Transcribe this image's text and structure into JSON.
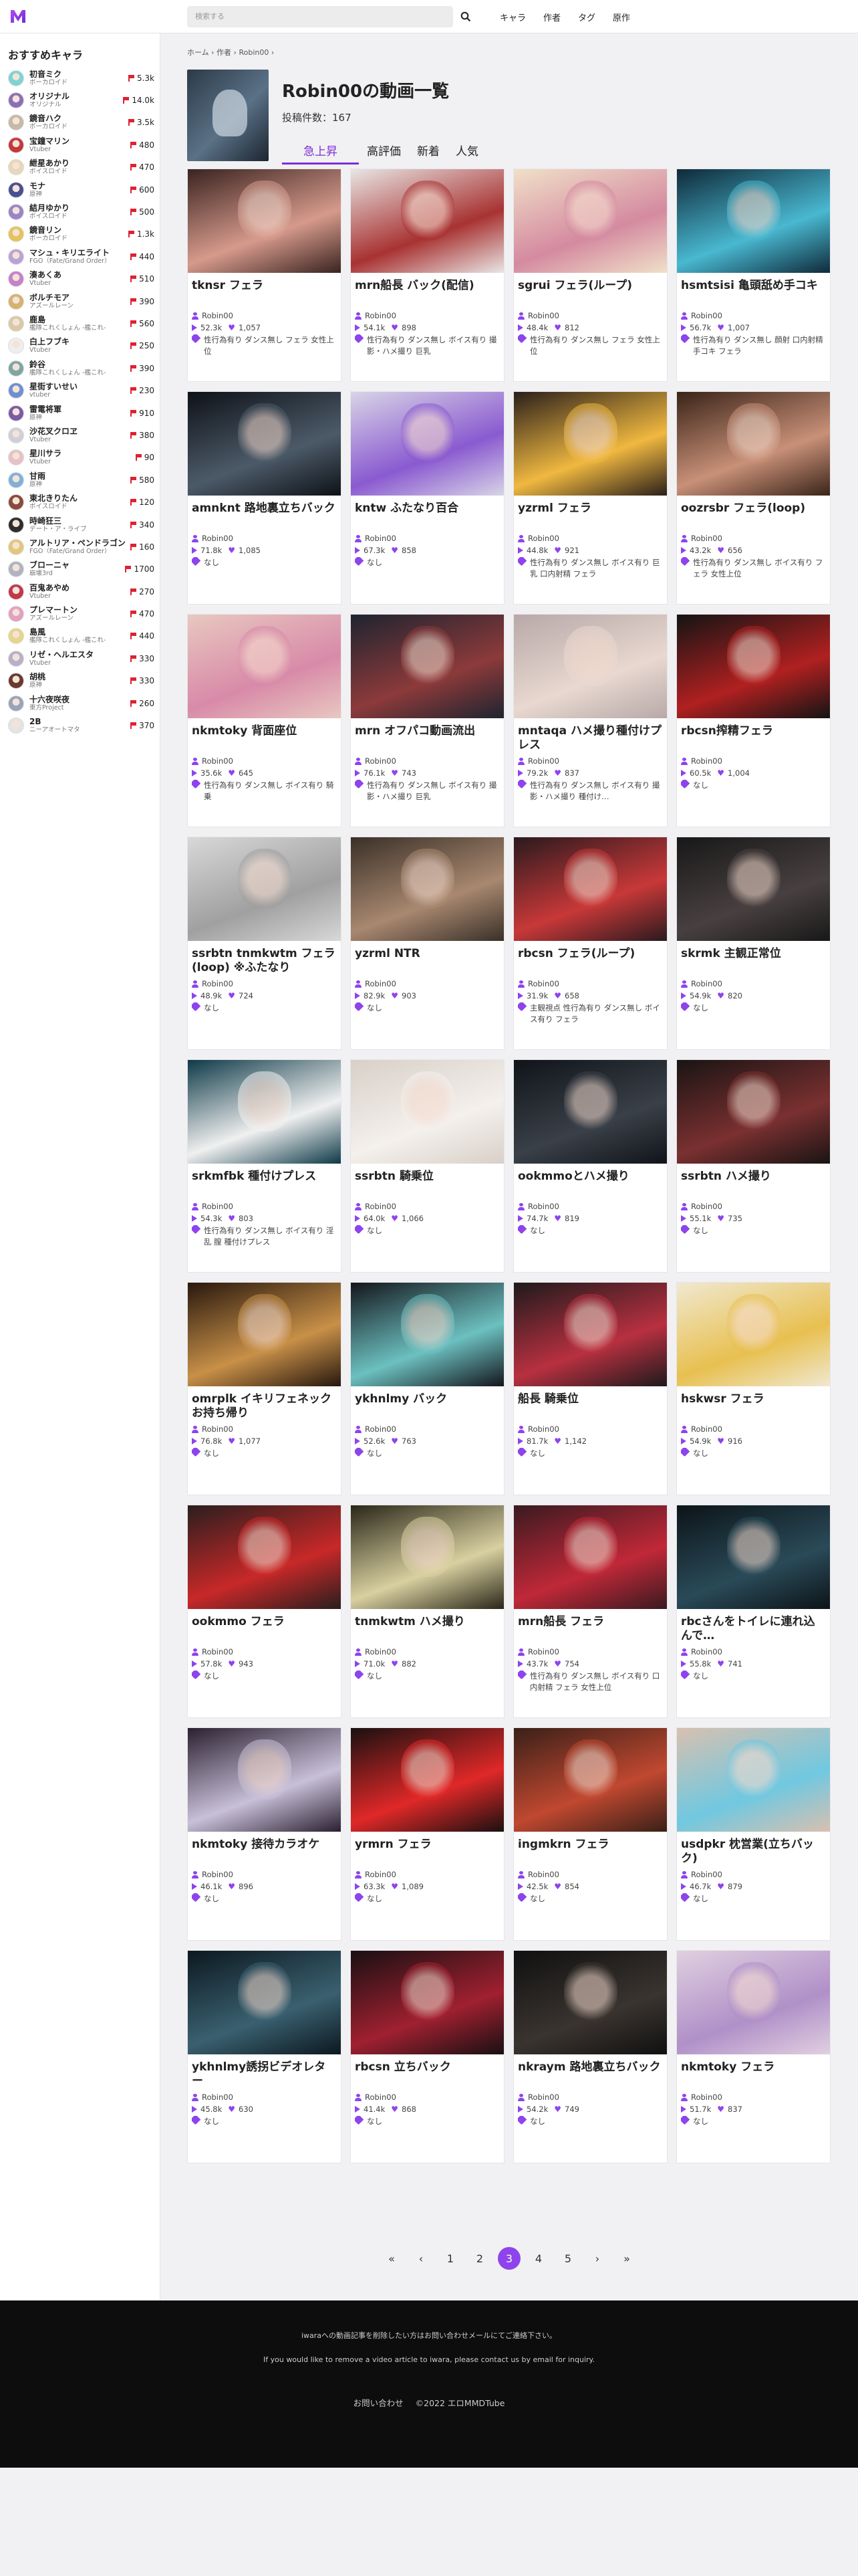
{
  "topbar": {
    "search_placeholder": "検索する",
    "nav": [
      "キャラ",
      "作者",
      "タグ",
      "原作"
    ]
  },
  "sidebar": {
    "title": "おすすめキャラ",
    "items": [
      {
        "name": "初音ミク",
        "sub": "ボーカロイド",
        "count": "5.3k",
        "avatar": "#7fd3d3"
      },
      {
        "name": "オリジナル",
        "sub": "オリジナル",
        "count": "14.0k",
        "avatar": "#8a6fb8"
      },
      {
        "name": "鏡音ハク",
        "sub": "ボーカロイド",
        "count": "3.5k",
        "avatar": "#c7b8a8"
      },
      {
        "name": "宝鐘マリン",
        "sub": "Vtuber",
        "count": "480",
        "avatar": "#c23a3a"
      },
      {
        "name": "紲星あかり",
        "sub": "ボイスロイド",
        "count": "470",
        "avatar": "#e8d7b8"
      },
      {
        "name": "モナ",
        "sub": "原神",
        "count": "600",
        "avatar": "#4a4f8f"
      },
      {
        "name": "結月ゆかり",
        "sub": "ボイスロイド",
        "count": "500",
        "avatar": "#9a85c8"
      },
      {
        "name": "鏡音リン",
        "sub": "ボーカロイド",
        "count": "1.3k",
        "avatar": "#e6c35a"
      },
      {
        "name": "マシュ・キリエライト",
        "sub": "FGO（Fate/Grand Order）",
        "count": "440",
        "avatar": "#b9a3d6"
      },
      {
        "name": "湊あくあ",
        "sub": "Vtuber",
        "count": "510",
        "avatar": "#c681c9"
      },
      {
        "name": "ボルチモア",
        "sub": "アズールレーン",
        "count": "390",
        "avatar": "#d8b070"
      },
      {
        "name": "鹿島",
        "sub": "艦隊これくしょん -艦これ-",
        "count": "560",
        "avatar": "#d9c9a6"
      },
      {
        "name": "白上フブキ",
        "sub": "Vtuber",
        "count": "250",
        "avatar": "#eeeeee"
      },
      {
        "name": "鈴谷",
        "sub": "艦隊これくしょん -艦これ-",
        "count": "390",
        "avatar": "#7fa6a0"
      },
      {
        "name": "星街すいせい",
        "sub": "vtuber",
        "count": "230",
        "avatar": "#6f8fd0"
      },
      {
        "name": "雷電将軍",
        "sub": "原神",
        "count": "910",
        "avatar": "#7b5aa6"
      },
      {
        "name": "沙花叉クロヱ",
        "sub": "Vtuber",
        "count": "380",
        "avatar": "#cfcfd8"
      },
      {
        "name": "星川サラ",
        "sub": "Vtuber",
        "count": "90",
        "avatar": "#e8c0c8"
      },
      {
        "name": "甘雨",
        "sub": "原神",
        "count": "580",
        "avatar": "#7fb0d9"
      },
      {
        "name": "東北きりたん",
        "sub": "ボイスロイド",
        "count": "120",
        "avatar": "#8a4b3a"
      },
      {
        "name": "時崎狂三",
        "sub": "デート・ア・ライブ",
        "count": "340",
        "avatar": "#2e2e2e"
      },
      {
        "name": "アルトリア・ペンドラゴン",
        "sub": "FGO（Fate/Grand Order）",
        "count": "160",
        "avatar": "#e2c77a"
      },
      {
        "name": "ブローニャ",
        "sub": "崩壊3rd",
        "count": "1700",
        "avatar": "#b0b4c0"
      },
      {
        "name": "百鬼あやめ",
        "sub": "Vtuber",
        "count": "270",
        "avatar": "#c03a4a"
      },
      {
        "name": "プレマートン",
        "sub": "アズールレーン",
        "count": "470",
        "avatar": "#e4a0c0"
      },
      {
        "name": "島風",
        "sub": "艦隊これくしょん -艦これ-",
        "count": "440",
        "avatar": "#e8d48a"
      },
      {
        "name": "リゼ・ヘルエスタ",
        "sub": "Vtuber",
        "count": "330",
        "avatar": "#b8b0c8"
      },
      {
        "name": "胡桃",
        "sub": "原神",
        "count": "330",
        "avatar": "#6b3a2e"
      },
      {
        "name": "十六夜咲夜",
        "sub": "東方Project",
        "count": "260",
        "avatar": "#9aa3b8"
      },
      {
        "name": "2B",
        "sub": "ニーアオートマタ",
        "count": "370",
        "avatar": "#e4e4e4"
      }
    ]
  },
  "breadcrumb": "ホーム › 作者 › Robin00 ›",
  "header": {
    "title": "Robin00の動画一覧",
    "count": "投稿件数：167",
    "tabs": [
      "急上昇",
      "高評価",
      "新着",
      "人気"
    ]
  },
  "videos": [
    {
      "title": "tknsr フェラ",
      "author": "Robin00",
      "views": "52.3k",
      "likes": "1,057",
      "tags": "性行為有り ダンス無し フェラ 女性上位",
      "c1": "#3a2320",
      "c2": "#d69a8c"
    },
    {
      "title": "mrn船長 バック(配信)",
      "author": "Robin00",
      "views": "54.1k",
      "likes": "898",
      "tags": "性行為有り ダンス無し ボイス有り 撮影・ハメ撮り 巨乳",
      "c1": "#e8e6e4",
      "c2": "#a83232"
    },
    {
      "title": "sgrui フェラ(ループ)",
      "author": "Robin00",
      "views": "48.4k",
      "likes": "812",
      "tags": "性行為有り ダンス無し フェラ 女性上位",
      "c1": "#f0e0c8",
      "c2": "#d48aa0"
    },
    {
      "title": "hsmtsisi 亀頭舐め手コキ",
      "author": "Robin00",
      "views": "56.7k",
      "likes": "1,007",
      "tags": "性行為有り ダンス無し 顔射 口内射精 手コキ フェラ",
      "c1": "#0f2a3a",
      "c2": "#49b8d0"
    },
    {
      "title": "amnknt 路地裏立ちバック",
      "author": "Robin00",
      "views": "71.8k",
      "likes": "1,085",
      "tags": "なし",
      "c1": "#0e1218",
      "c2": "#4c5a68"
    },
    {
      "title": "kntw ふたなり百合",
      "author": "Robin00",
      "views": "67.3k",
      "likes": "858",
      "tags": "なし",
      "c1": "#d8d4e6",
      "c2": "#8a5ad0"
    },
    {
      "title": "yzrml フェラ",
      "author": "Robin00",
      "views": "44.8k",
      "likes": "921",
      "tags": "性行為有り ダンス無し ボイス有り 巨乳 口内射精 フェラ",
      "c1": "#2a1f1a",
      "c2": "#f0b840"
    },
    {
      "title": "oozrsbr フェラ(loop)",
      "author": "Robin00",
      "views": "43.2k",
      "likes": "656",
      "tags": "性行為有り ダンス無し ボイス有り フェラ 女性上位",
      "c1": "#3a2418",
      "c2": "#c89078"
    },
    {
      "title": "nkmtoky 背面座位",
      "author": "Robin00",
      "views": "35.6k",
      "likes": "645",
      "tags": "性行為有り ダンス無し ボイス有り 騎乗",
      "c1": "#e8c8c0",
      "c2": "#d88aa8"
    },
    {
      "title": "mrn オフパコ動画流出",
      "author": "Robin00",
      "views": "76.1k",
      "likes": "743",
      "tags": "性行為有り ダンス無し ボイス有り 撮影・ハメ撮り 巨乳",
      "c1": "#1e2430",
      "c2": "#8c3a3a"
    },
    {
      "title": "mntaqa ハメ撮り種付けプレス",
      "author": "Robin00",
      "views": "79.2k",
      "likes": "837",
      "tags": "性行為有り ダンス無し ボイス有り 撮影・ハメ撮り 種付け…",
      "c1": "#b8a8a8",
      "c2": "#e8d8d0"
    },
    {
      "title": "rbcsn搾精フェラ",
      "author": "Robin00",
      "views": "60.5k",
      "likes": "1,004",
      "tags": "なし",
      "c1": "#141414",
      "c2": "#b02020"
    },
    {
      "title": "ssrbtn tnmkwtm フェラ(loop) ※ふたなり",
      "author": "Robin00",
      "views": "48.9k",
      "likes": "724",
      "tags": "なし",
      "c1": "#d8d8d8",
      "c2": "#a0a0a0"
    },
    {
      "title": "yzrml NTR",
      "author": "Robin00",
      "views": "82.9k",
      "likes": "903",
      "tags": "なし",
      "c1": "#3a3028",
      "c2": "#a88870"
    },
    {
      "title": "rbcsn フェラ(ループ)",
      "author": "Robin00",
      "views": "31.9k",
      "likes": "658",
      "tags": "主観視点 性行為有り ダンス無し ボイス有り フェラ",
      "c1": "#2a1a1e",
      "c2": "#c83838"
    },
    {
      "title": "skrmk 主観正常位",
      "author": "Robin00",
      "views": "54.9k",
      "likes": "820",
      "tags": "なし",
      "c1": "#181818",
      "c2": "#484040"
    },
    {
      "title": "srkmfbk 種付けプレス",
      "author": "Robin00",
      "views": "54.3k",
      "likes": "803",
      "tags": "性行為有り ダンス無し ボイス有り 淫乱 膣 種付けプレス",
      "c1": "#0e3a48",
      "c2": "#f0f0f0"
    },
    {
      "title": "ssrbtn 騎乗位",
      "author": "Robin00",
      "views": "64.0k",
      "likes": "1,066",
      "tags": "なし",
      "c1": "#d8d0c8",
      "c2": "#f4f0ec"
    },
    {
      "title": "ookmmoとハメ撮り",
      "author": "Robin00",
      "views": "74.7k",
      "likes": "819",
      "tags": "なし",
      "c1": "#10141a",
      "c2": "#3a4048"
    },
    {
      "title": "ssrbtn ハメ撮り",
      "author": "Robin00",
      "views": "55.1k",
      "likes": "735",
      "tags": "なし",
      "c1": "#1a1414",
      "c2": "#7a3030"
    },
    {
      "title": "omrplk イキリフェネック お持ち帰り",
      "author": "Robin00",
      "views": "76.8k",
      "likes": "1,077",
      "tags": "なし",
      "c1": "#28180e",
      "c2": "#c89048"
    },
    {
      "title": "ykhnlmy バック",
      "author": "Robin00",
      "views": "52.6k",
      "likes": "763",
      "tags": "なし",
      "c1": "#14161c",
      "c2": "#6cc0c0"
    },
    {
      "title": "船長 騎乗位",
      "author": "Robin00",
      "views": "81.7k",
      "likes": "1,142",
      "tags": "なし",
      "c1": "#1e1a1c",
      "c2": "#b83040"
    },
    {
      "title": "hskwsr フェラ",
      "author": "Robin00",
      "views": "54.9k",
      "likes": "916",
      "tags": "なし",
      "c1": "#f0e8d0",
      "c2": "#e8c050"
    },
    {
      "title": "ookmmo フェラ",
      "author": "Robin00",
      "views": "57.8k",
      "likes": "943",
      "tags": "なし",
      "c1": "#2a1e1e",
      "c2": "#c82828"
    },
    {
      "title": "tnmkwtm ハメ撮り",
      "author": "Robin00",
      "views": "71.0k",
      "likes": "882",
      "tags": "なし",
      "c1": "#2a2618",
      "c2": "#d8d0a0"
    },
    {
      "title": "mrn船長 フェラ",
      "author": "Robin00",
      "views": "43.7k",
      "likes": "754",
      "tags": "性行為有り ダンス無し ボイス有り 口内射精 フェラ 女性上位",
      "c1": "#3a1a20",
      "c2": "#c02838"
    },
    {
      "title": "rbcさんをトイレに連れ込んで…",
      "author": "Robin00",
      "views": "55.8k",
      "likes": "741",
      "tags": "なし",
      "c1": "#0c1418",
      "c2": "#2a4a58"
    },
    {
      "title": "nkmtoky 接待カラオケ",
      "author": "Robin00",
      "views": "46.1k",
      "likes": "896",
      "tags": "なし",
      "c1": "#2a2030",
      "c2": "#c8c0d8"
    },
    {
      "title": "yrmrn フェラ",
      "author": "Robin00",
      "views": "63.3k",
      "likes": "1,089",
      "tags": "なし",
      "c1": "#1a1010",
      "c2": "#e02828"
    },
    {
      "title": "ingmkrn フェラ",
      "author": "Robin00",
      "views": "42.5k",
      "likes": "854",
      "tags": "なし",
      "c1": "#3a2018",
      "c2": "#c04830"
    },
    {
      "title": "usdpkr 枕営業(立ちバック)",
      "author": "Robin00",
      "views": "46.7k",
      "likes": "879",
      "tags": "なし",
      "c1": "#d8c0b0",
      "c2": "#70c8e0"
    },
    {
      "title": "ykhnlmy誘拐ビデオレター",
      "author": "Robin00",
      "views": "45.8k",
      "likes": "630",
      "tags": "なし",
      "c1": "#0c1820",
      "c2": "#3a6070"
    },
    {
      "title": "rbcsn 立ちバック",
      "author": "Robin00",
      "views": "41.4k",
      "likes": "868",
      "tags": "なし",
      "c1": "#181012",
      "c2": "#a02030"
    },
    {
      "title": "nkraym 路地裏立ちバック",
      "author": "Robin00",
      "views": "54.2k",
      "likes": "749",
      "tags": "なし",
      "c1": "#101010",
      "c2": "#3a3430"
    },
    {
      "title": "nkmtoky フェラ",
      "author": "Robin00",
      "views": "51.7k",
      "likes": "837",
      "tags": "なし",
      "c1": "#e0d0e0",
      "c2": "#b090c8"
    }
  ],
  "pagination": {
    "first": "«",
    "prev": "‹",
    "pages": [
      "1",
      "2",
      "3",
      "4",
      "5"
    ],
    "current": "3",
    "next": "›",
    "last": "»"
  },
  "footer": {
    "notice_ja": "iwaraへの動画記事を削除したい方はお問い合わせメールにてご連絡下さい。",
    "notice_en": "If you would like to remove a video article to iwara, please contact us by email for inquiry.",
    "contact": "お問い合わせ",
    "copyright": "©2022 エロMMDTube"
  },
  "colors": {
    "accent": "#8e44ec",
    "flag": "#dd2233"
  }
}
